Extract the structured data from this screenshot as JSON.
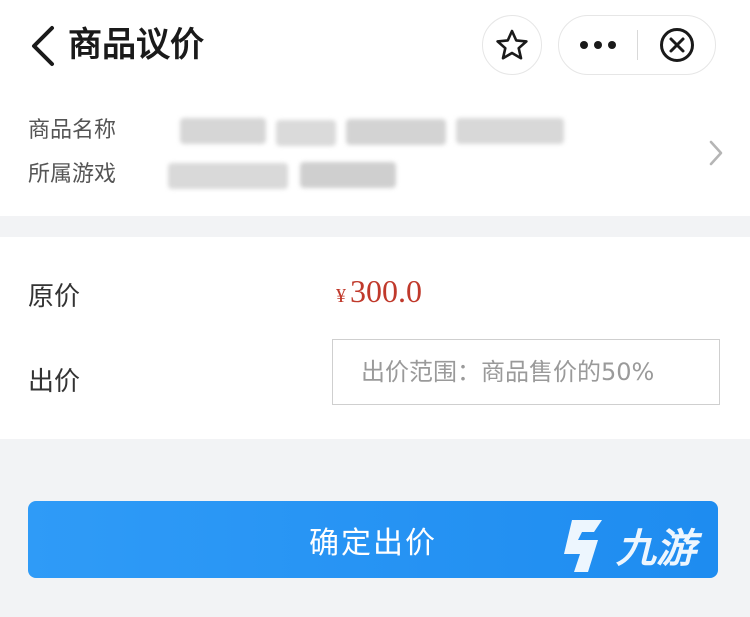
{
  "header": {
    "title": "商品议价",
    "back_icon": "chevron-left-icon",
    "star_icon": "star-outline-icon",
    "more_icon": "more-dots-icon",
    "close_icon": "close-circle-icon"
  },
  "goods_info": {
    "name_label": "商品名称",
    "game_label": "所属游戏",
    "arrow_icon": "chevron-right-icon"
  },
  "offer_form": {
    "original_price_label": "原价",
    "currency_symbol": "¥",
    "original_price": "300.0",
    "offer_label": "出价",
    "offer_placeholder": "出价范围：商品售价的50%",
    "offer_value": ""
  },
  "actions": {
    "confirm_label": "确定出价"
  },
  "watermark": {
    "text": "九游"
  },
  "colors": {
    "accent_blue": "#1e8cf0",
    "price_red": "#c0392b",
    "page_bg": "#f2f3f5"
  }
}
